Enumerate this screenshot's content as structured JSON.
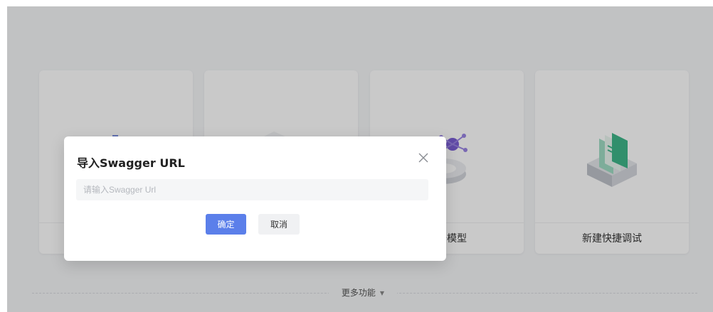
{
  "cards": [
    {
      "label": "",
      "icon": "import-icon"
    },
    {
      "label": "",
      "icon": "document-icon"
    },
    {
      "label": "数据模型",
      "icon": "data-model-icon"
    },
    {
      "label": "新建快捷调试",
      "icon": "quick-debug-icon"
    }
  ],
  "more": {
    "label": "更多功能",
    "caret": "▼"
  },
  "dialog": {
    "title": "导入Swagger URL",
    "input_placeholder": "请输入Swagger Url",
    "input_value": "",
    "ok_label": "确定",
    "cancel_label": "取消"
  },
  "colors": {
    "primary": "#5b7fea",
    "mask": "rgba(0,0,0,0.21)",
    "card_bg": "#ffffff",
    "page_bg": "#f5f6f8"
  }
}
